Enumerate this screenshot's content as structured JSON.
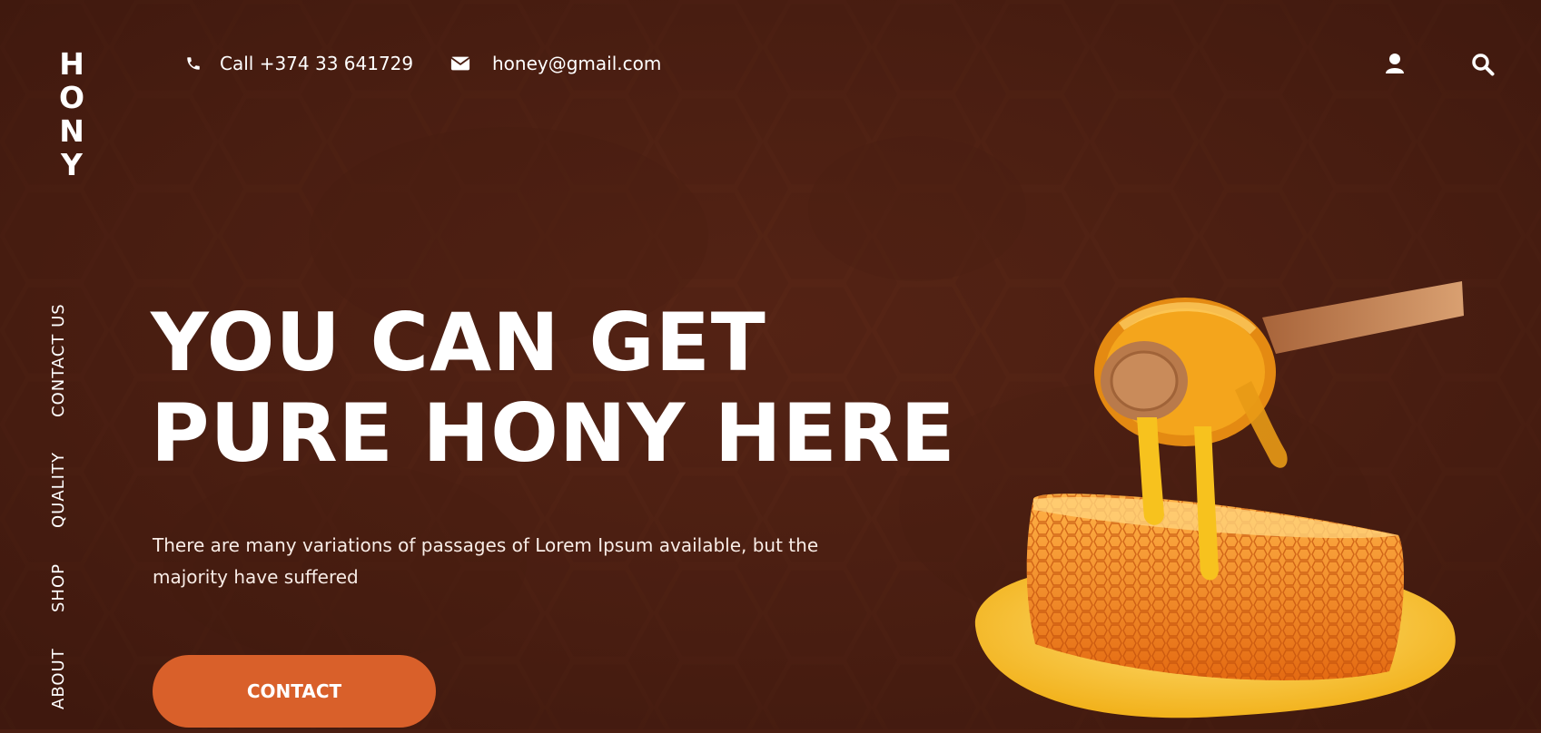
{
  "brand": {
    "logo_letters": [
      "H",
      "O",
      "N",
      "Y"
    ]
  },
  "side_nav": {
    "items": [
      {
        "label": "CONTACT US"
      },
      {
        "label": "QUALITY"
      },
      {
        "label": "SHOP"
      },
      {
        "label": "ABOUT"
      }
    ]
  },
  "header": {
    "phone": {
      "icon": "phone-icon",
      "text": "Call +374 33 641729"
    },
    "email": {
      "icon": "envelope-icon",
      "text": "honey@gmail.com"
    },
    "actions": {
      "user_icon": "user-icon",
      "search_icon": "search-icon"
    }
  },
  "hero": {
    "headline_line1": "YOU CAN GET",
    "headline_line2": "PURE HONY HERE",
    "description": "There are many variations of passages of Lorem Ipsum available, but the majority have suffered",
    "cta_label": "CONTACT"
  },
  "colors": {
    "background": "#4a1e12",
    "accent": "#d9602a",
    "honey": "#f5a623",
    "text": "#ffffff"
  }
}
